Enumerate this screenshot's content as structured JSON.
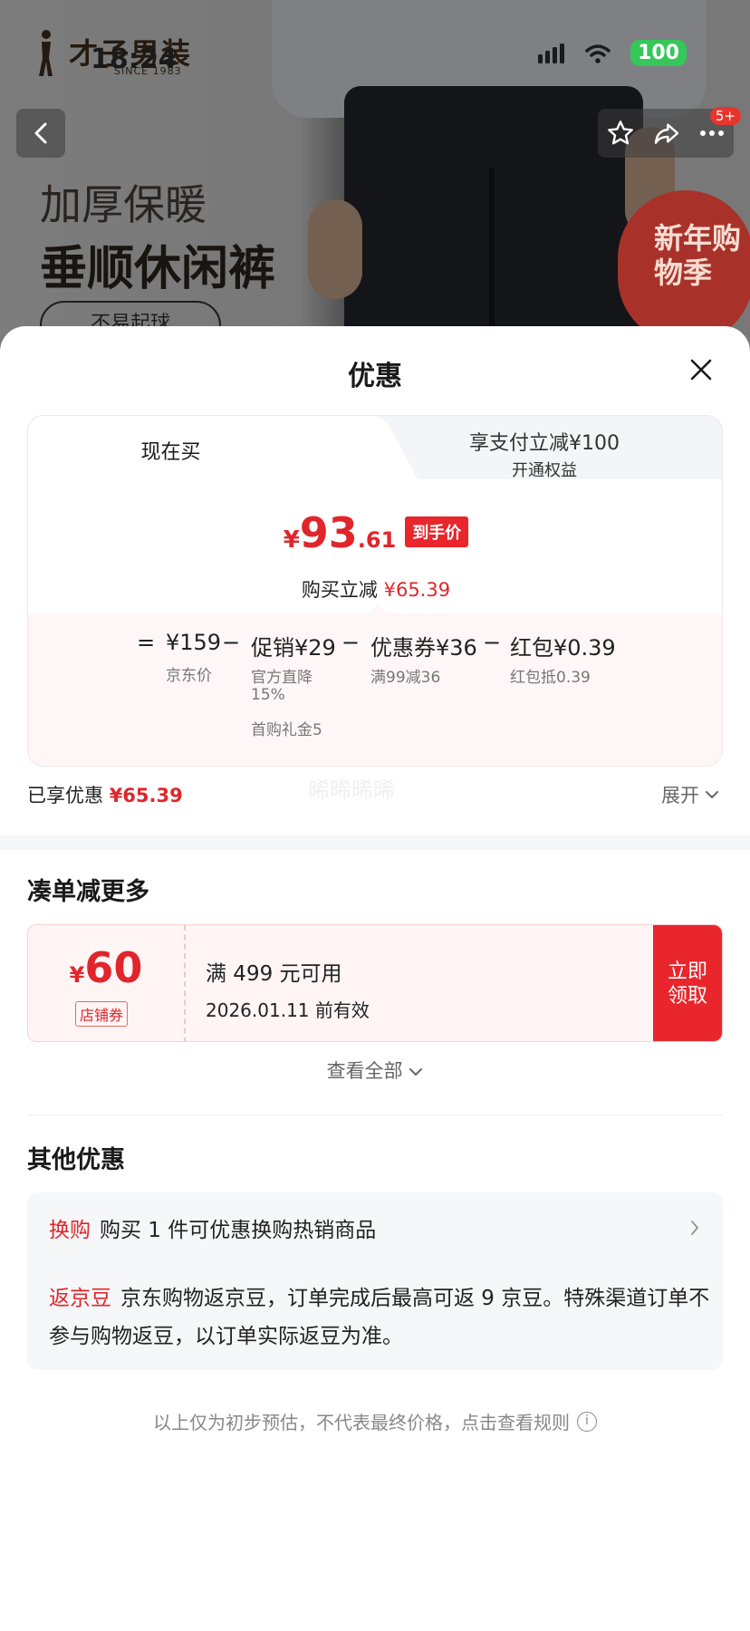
{
  "status_bar": {
    "time": "18:24",
    "battery": "100"
  },
  "background": {
    "brand_name": "才子男装",
    "brand_since": "SINCE 1983",
    "promo_line1": "加厚保暖",
    "promo_line2": "垂顺休闲裤",
    "promo_pill": "不易起球",
    "banner_text": "新年购物季",
    "notification_badge": "5+"
  },
  "sheet": {
    "title": "优惠",
    "tabs": {
      "now": "现在买",
      "pay_line1": "享支付立减¥100",
      "pay_line2": "开通权益"
    },
    "final_price": {
      "currency": "¥",
      "integer": "93",
      "decimal": ".61",
      "tag": "到手价"
    },
    "reduce_label": "购买立减",
    "reduce_amount": "¥65.39",
    "breakdown": {
      "eq": "=",
      "jd_price": "¥159",
      "jd_price_label": "京东价",
      "minus1": "−",
      "promo": "促销¥29",
      "promo_sub1": "官方直降",
      "promo_sub2": "15%",
      "promo_sub3": "首购礼金5",
      "minus2": "−",
      "coupon": "优惠券¥36",
      "coupon_sub": "满99减36",
      "minus3": "−",
      "redpack": "红包¥0.39",
      "redpack_sub": "红包抵0.39"
    },
    "enjoyed_label": "已享优惠",
    "enjoyed_amount": "¥65.39",
    "expand_label": "展开",
    "watermark": "晞晞晞晞",
    "more_section_title": "凑单减更多",
    "coupon_card": {
      "currency": "¥",
      "amount": "60",
      "type": "店铺券",
      "condition": "满 499 元可用",
      "expiry": "2026.01.11 前有效",
      "claim_line1": "立即",
      "claim_line2": "领取"
    },
    "view_all": "查看全部",
    "other_section_title": "其他优惠",
    "other_items": {
      "swap_tag": "换购",
      "swap_text": "购买 1 件可优惠换购热销商品",
      "bean_tag": "返京豆",
      "bean_text": "京东购物返京豆，订单完成后最高可返 9 京豆。特殊渠道订单不参与购物返豆，以订单实际返豆为准。"
    },
    "disclaimer": "以上仅为初步预估，不代表最终价格，点击查看规则",
    "info_glyph": "i"
  },
  "colors": {
    "accent_red": "#e0262b",
    "claim_red": "#e8262c",
    "battery_green": "#35c759"
  }
}
